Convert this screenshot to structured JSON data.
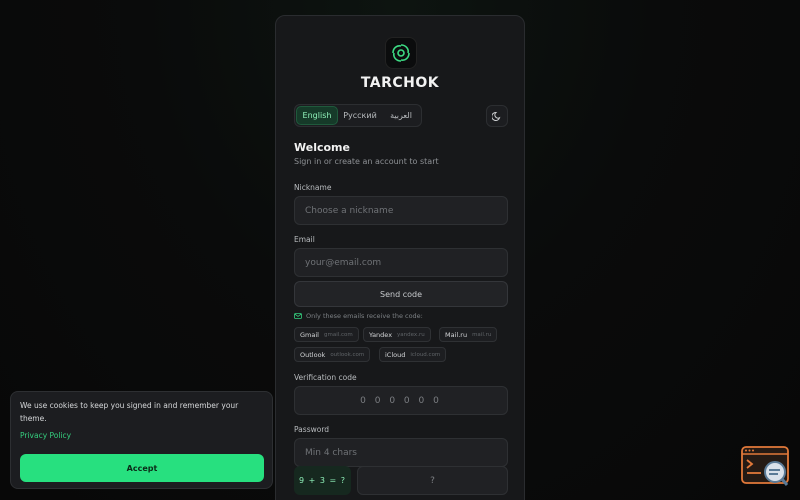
{
  "brand": {
    "name": "TARCHOK",
    "logo_icon": "spiral-logo-icon",
    "accent": "#27e07f"
  },
  "languages": [
    {
      "label": "English",
      "active": true
    },
    {
      "label": "Русский",
      "active": false
    },
    {
      "label": "العربية",
      "active": false
    }
  ],
  "theme_toggle": {
    "icon": "moon-icon"
  },
  "header": {
    "title": "Welcome",
    "subtitle": "Sign in or create an account to start"
  },
  "form": {
    "nickname": {
      "label": "Nickname",
      "placeholder": "Choose a nickname"
    },
    "email": {
      "label": "Email",
      "placeholder": "your@email.com"
    },
    "send_code": "Send code",
    "allowed_note": "Only these emails receive the code:",
    "providers": [
      {
        "name": "Gmail",
        "domain": "gmail.com"
      },
      {
        "name": "Yandex",
        "domain": "yandex.ru"
      },
      {
        "name": "Mail.ru",
        "domain": "mail.ru"
      },
      {
        "name": "Outlook",
        "domain": "outlook.com"
      },
      {
        "name": "iCloud",
        "domain": "icloud.com"
      }
    ],
    "verification": {
      "label": "Verification code",
      "placeholder": "0 0 0 0 0 0"
    },
    "password": {
      "label": "Password",
      "placeholder": "Min 4 chars"
    },
    "captcha": {
      "question": "9 + 3 = ?",
      "answer_placeholder": "?"
    }
  },
  "cookie_banner": {
    "text": "We use cookies to keep you signed in and remember your theme.",
    "link": "Privacy Policy",
    "button": "Accept"
  },
  "corner_widget": {
    "icon": "terminal-search-icon"
  }
}
